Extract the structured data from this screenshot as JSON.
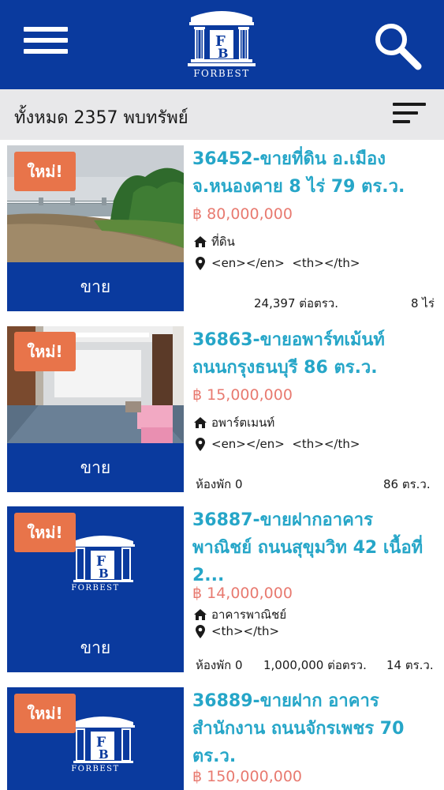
{
  "header": {
    "logo_text": "FORBEST",
    "menu_icon": "hamburger-icon",
    "search_icon": "search-icon",
    "brand_color": "#0a3a9e"
  },
  "filter": {
    "total_text": "ทั้งหมด 2357 พบทรัพย์",
    "sort_icon": "sort-icon"
  },
  "listings": [
    {
      "badge": "ใหม่!",
      "sale_label": "ขาย",
      "title_line1": "36452-ขายที่ดิน อ.เมือง",
      "title_line2": "จ.หนองคาย 8 ไร่ 79 ตร.ว.",
      "price": "฿ 80,000,000",
      "type": "ที่ดิน",
      "location": "<en></en>  <th></th>",
      "stat_a": "24,397 ต่อตรว.",
      "stat_b": "8 ไร่"
    },
    {
      "badge": "ใหม่!",
      "sale_label": "ขาย",
      "title_line1": "36863-ขายอพาร์ทเม้นท์",
      "title_line2": "ถนนกรุงธนบุรี 86 ตร.ว.",
      "price": "฿ 15,000,000",
      "type": "อพาร์ตเมนท์",
      "location": "<en></en>  <th></th>",
      "stat_a": "ห้องพัก 0",
      "stat_b": "86 ตร.ว."
    },
    {
      "badge": "ใหม่!",
      "sale_label": "ขาย",
      "title_line1": "36887-ขายฝากอาคาร",
      "title_line2": "พาณิชย์ ถนนสุขุมวิท 42 เนื้อที่",
      "title_line3": "2...",
      "price": "฿ 14,000,000",
      "type": "อาคารพาณิชย์",
      "location": "<th></th>",
      "stat_a": "ห้องพัก 0",
      "stat_b": "1,000,000 ต่อตรว.",
      "stat_c": "14 ตร.ว.",
      "thumb_logo_text": "FORBEST"
    },
    {
      "badge": "ใหม่!",
      "title_line1": "36889-ขายฝาก อาคาร",
      "title_line2": "สำนักงาน ถนนจักรเพชร 70",
      "title_line3": "ตร.ว.",
      "price": "฿ 150,000,000",
      "thumb_logo_text": "FORBEST"
    }
  ]
}
